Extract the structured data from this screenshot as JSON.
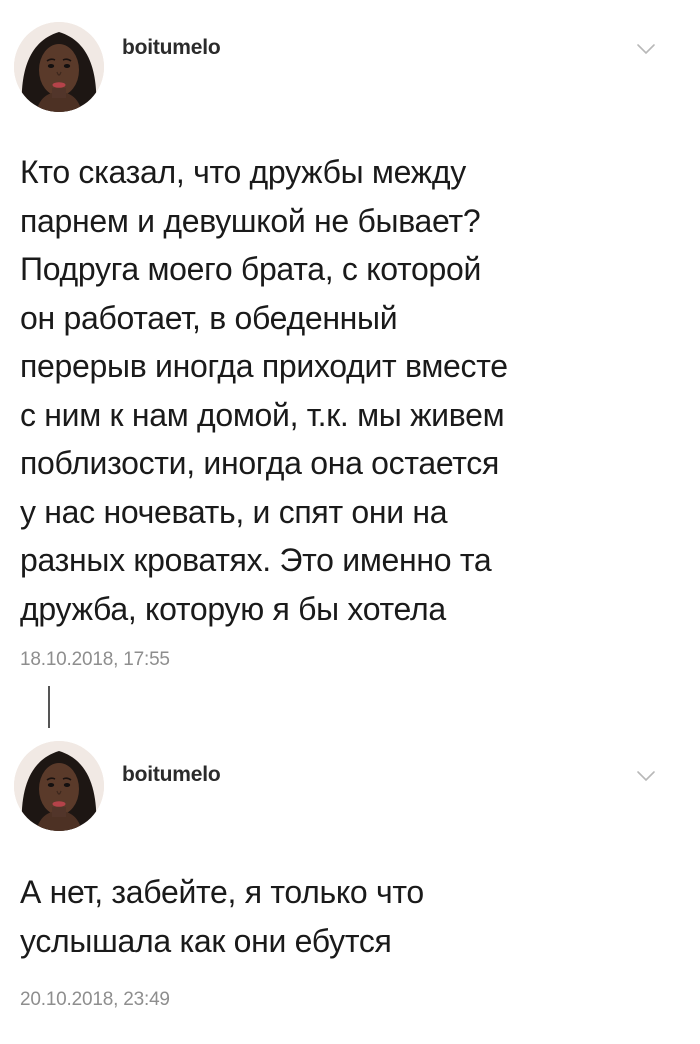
{
  "posts": [
    {
      "username": "boitumelo",
      "text": "Кто сказал, что дружбы между\nпарнем и девушкой не бывает?\nПодруга моего брата, с которой\nон работает, в обеденный\nперерыв иногда приходит вместе\nс ним к нам домой, т.к. мы живем\nпоблизости, иногда она остается\nу нас ночевать, и спят они на\nразных кроватях. Это именно та\nдружба, которую я бы хотела",
      "timestamp": "18.10.2018, 17:55",
      "menu_icon": "chevron-down-icon"
    },
    {
      "username": "boitumelo",
      "text": "А нет, забейте, я только что\nуслышала как они ебутся",
      "timestamp": "20.10.2018, 23:49",
      "menu_icon": "chevron-down-icon"
    }
  ],
  "colors": {
    "text": "#1a1a1a",
    "username": "#2b2b2b",
    "timestamp": "#8e8e8e",
    "thread_line": "#555555",
    "chevron": "#b8b8b8"
  }
}
